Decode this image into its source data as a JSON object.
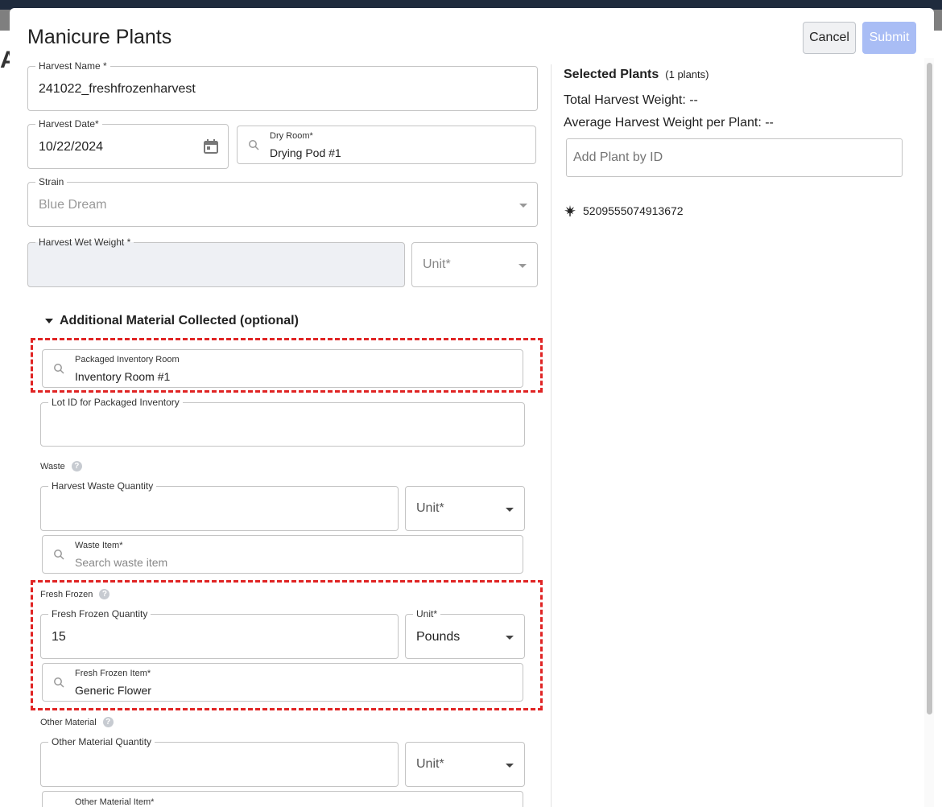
{
  "modal": {
    "title": "Manicure Plants",
    "cancel_label": "Cancel",
    "submit_label": "Submit"
  },
  "form": {
    "harvest_name": {
      "label": "Harvest Name *",
      "value": "241022_freshfrozenharvest"
    },
    "harvest_date": {
      "label": "Harvest Date*",
      "value": "10/22/2024"
    },
    "dry_room": {
      "label": "Dry Room*",
      "value": "Drying Pod #1"
    },
    "strain": {
      "label": "Strain",
      "value": "Blue Dream"
    },
    "wet_weight": {
      "label": "Harvest Wet Weight *",
      "value": ""
    },
    "wet_weight_unit": {
      "placeholder": "Unit*"
    }
  },
  "additional": {
    "title": "Additional Material Collected (optional)",
    "packaged_room": {
      "label": "Packaged Inventory Room",
      "value": "Inventory Room #1"
    },
    "lot_id": {
      "label": "Lot ID for Packaged Inventory",
      "value": ""
    },
    "waste": {
      "section_label": "Waste",
      "quantity_label": "Harvest Waste Quantity",
      "unit_placeholder": "Unit*",
      "item_label": "Waste Item*",
      "item_placeholder": "Search waste item"
    },
    "fresh_frozen": {
      "section_label": "Fresh Frozen",
      "quantity_label": "Fresh Frozen Quantity",
      "quantity_value": "15",
      "unit_label": "Unit*",
      "unit_value": "Pounds",
      "item_label": "Fresh Frozen Item*",
      "item_value": "Generic Flower"
    },
    "other": {
      "section_label": "Other Material",
      "quantity_label": "Other Material Quantity",
      "unit_placeholder": "Unit*",
      "item_label": "Other Material Item*"
    }
  },
  "selected": {
    "title": "Selected Plants",
    "count": "(1 plants)",
    "total_weight": "Total Harvest Weight: --",
    "avg_weight": "Average Harvest Weight per Plant: --",
    "add_placeholder": "Add Plant by ID",
    "plants": [
      "5209555074913672"
    ]
  },
  "background": {
    "heading_letter": "A"
  },
  "icons": {
    "calendar": "calendar-icon",
    "search": "search-icon",
    "help": "help-icon",
    "plant": "cannabis-leaf-icon"
  },
  "colors": {
    "submit_disabled": "#a9bdf5",
    "highlight_dash": "#e02424"
  }
}
